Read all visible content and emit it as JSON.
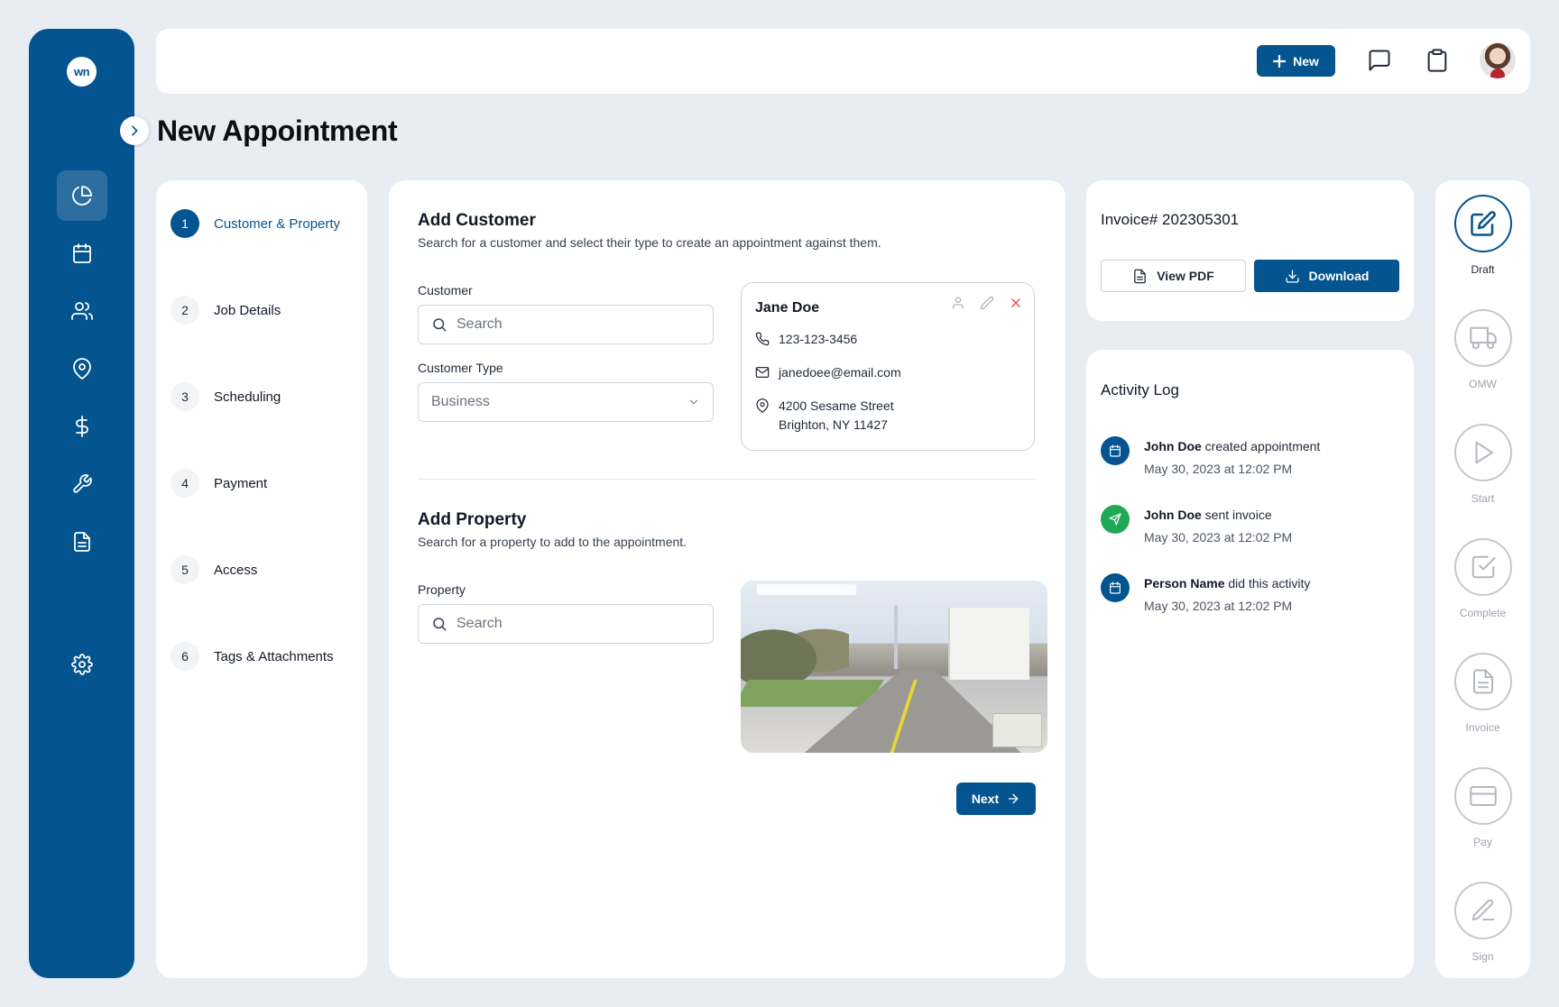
{
  "sidebar": {
    "logo": "wn",
    "items": [
      {
        "name": "dashboard",
        "icon": "pie-chart-icon",
        "active": true
      },
      {
        "name": "calendar",
        "icon": "calendar-icon"
      },
      {
        "name": "customers",
        "icon": "users-icon"
      },
      {
        "name": "locations",
        "icon": "map-pin-icon"
      },
      {
        "name": "billing",
        "icon": "dollar-icon"
      },
      {
        "name": "tools",
        "icon": "wrench-icon"
      },
      {
        "name": "documents",
        "icon": "file-icon"
      },
      {
        "name": "settings",
        "icon": "gear-icon"
      }
    ]
  },
  "header": {
    "new_label": "New"
  },
  "page": {
    "title": "New Appointment"
  },
  "steps": [
    {
      "num": "1",
      "label": "Customer & Property"
    },
    {
      "num": "2",
      "label": "Job Details"
    },
    {
      "num": "3",
      "label": "Scheduling"
    },
    {
      "num": "4",
      "label": "Payment"
    },
    {
      "num": "5",
      "label": "Access"
    },
    {
      "num": "6",
      "label": "Tags & Attachments"
    }
  ],
  "add_customer": {
    "title": "Add Customer",
    "subtitle": "Search for a customer and select their type to create an appointment against them.",
    "customer_label": "Customer",
    "search_placeholder": "Search",
    "type_label": "Customer Type",
    "type_value": "Business"
  },
  "customer_card": {
    "name": "Jane Doe",
    "phone": "123-123-3456",
    "email": "janedoee@email.com",
    "address_line1": "4200 Sesame Street",
    "address_line2": "Brighton, NY 11427"
  },
  "add_property": {
    "title": "Add Property",
    "subtitle": "Search for a property to add to the appointment.",
    "property_label": "Property",
    "search_placeholder": "Search"
  },
  "next_label": "Next",
  "invoice": {
    "title": "Invoice# 202305301",
    "view_pdf": "View PDF",
    "download": "Download"
  },
  "activity": {
    "title": "Activity Log",
    "items": [
      {
        "actor": "John Doe",
        "action": " created appointment",
        "date": "May 30, 2023 at 12:02 PM"
      },
      {
        "actor": "John Doe",
        "action": " sent invoice",
        "date": "May 30, 2023 at 12:02 PM"
      },
      {
        "actor": "Person Name",
        "action": " did this activity",
        "date": "May 30, 2023 at 12:02 PM"
      }
    ]
  },
  "statuses": [
    {
      "label": "Draft",
      "icon": "edit-icon",
      "active": true
    },
    {
      "label": "OMW",
      "icon": "truck-icon"
    },
    {
      "label": "Start",
      "icon": "play-icon"
    },
    {
      "label": "Complete",
      "icon": "check-square-icon"
    },
    {
      "label": "Invoice",
      "icon": "invoice-icon"
    },
    {
      "label": "Pay",
      "icon": "credit-card-icon"
    },
    {
      "label": "Sign",
      "icon": "pen-icon"
    }
  ],
  "colors": {
    "primary": "#04548f",
    "background": "#e7edf3",
    "success": "#1fa955",
    "danger": "#ef4444"
  }
}
